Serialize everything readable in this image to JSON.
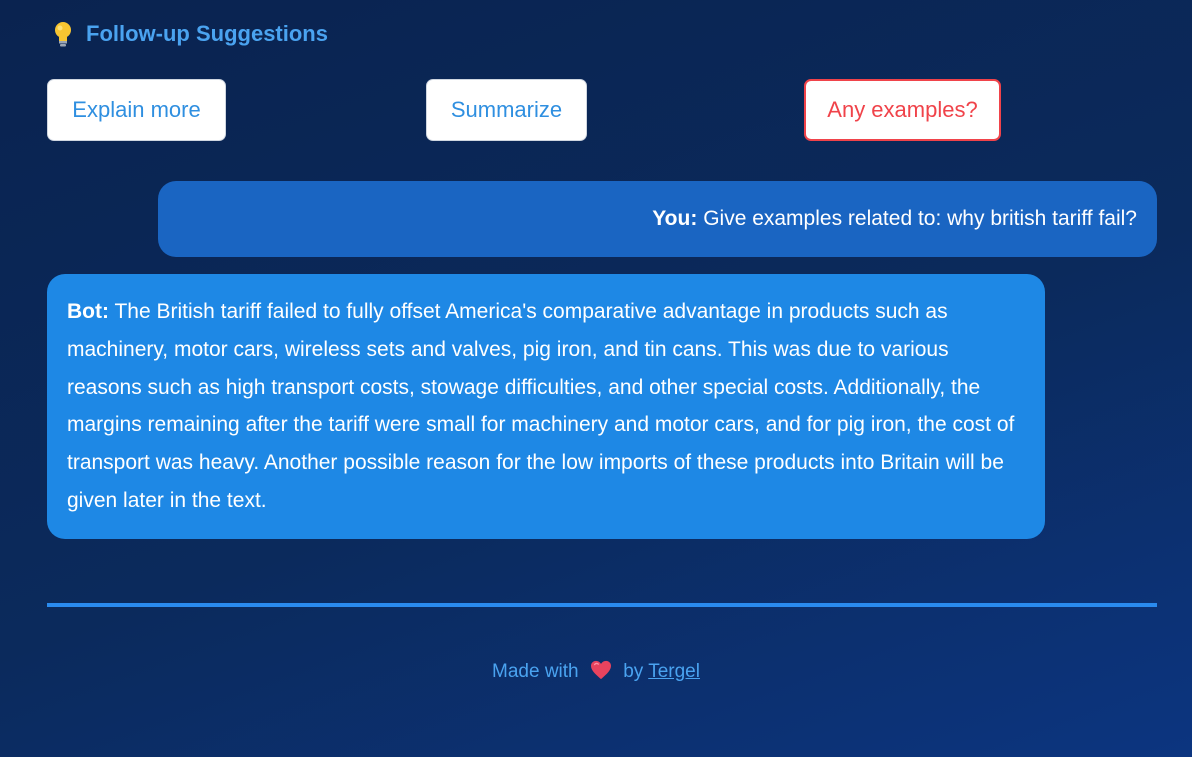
{
  "suggestions": {
    "title": "Follow-up Suggestions",
    "icon": "lightbulb-icon",
    "buttons": [
      {
        "label": "Explain more",
        "active": false
      },
      {
        "label": "Summarize",
        "active": false
      },
      {
        "label": "Any examples?",
        "active": true
      }
    ]
  },
  "chat": {
    "user": {
      "speaker": "You:",
      "text": "Give examples related to: why british tariff fail?"
    },
    "bot": {
      "speaker": "Bot:",
      "text": "The British tariff failed to fully offset America's comparative advantage in products such as machinery, motor cars, wireless sets and valves, pig iron, and tin cans. This was due to various reasons such as high transport costs, stowage difficulties, and other special costs. Additionally, the margins remaining after the tariff were small for machinery and motor cars, and for pig iron, the cost of transport was heavy. Another possible reason for the low imports of these products into Britain will be given later in the text."
    }
  },
  "footer": {
    "made_with": "Made with",
    "heart_icon": "heart-icon",
    "by": "by",
    "author": "Tergel"
  },
  "colors": {
    "accent": "#4aa3f0",
    "user_bubble": "#1a65c2",
    "bot_bubble": "#1e88e5",
    "active_suggestion": "#f0434a"
  }
}
